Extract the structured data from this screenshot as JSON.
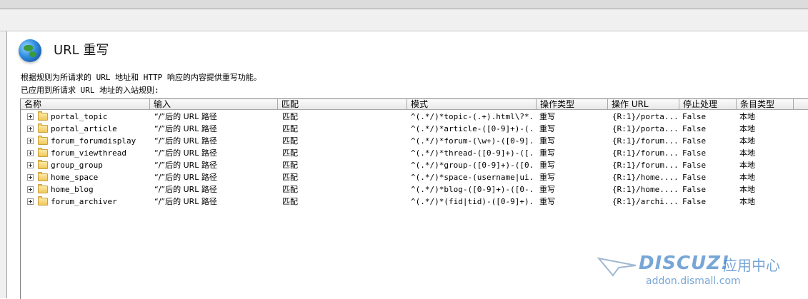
{
  "header": {
    "title": "URL 重写",
    "icon": "globe-icon"
  },
  "description": "根据规则为所请求的 URL 地址和 HTTP 响应的内容提供重写功能。",
  "applied_label": "已应用到所请求 URL 地址的入站规则:",
  "table": {
    "columns": [
      "名称",
      "输入",
      "匹配",
      "模式",
      "操作类型",
      "操作 URL",
      "停止处理",
      "条目类型"
    ],
    "rows": [
      {
        "name": "portal_topic",
        "input": "“/”后的 URL 路径",
        "match": "匹配",
        "pattern": "^(.*/)*topic-(.+).html\\?*...",
        "action_type": "重写",
        "action_url": "{R:1}/porta...",
        "stop": "False",
        "entry_type": "本地"
      },
      {
        "name": "portal_article",
        "input": "“/”后的 URL 路径",
        "match": "匹配",
        "pattern": "^(.*/)*article-([0-9]+)-(...",
        "action_type": "重写",
        "action_url": "{R:1}/porta...",
        "stop": "False",
        "entry_type": "本地"
      },
      {
        "name": "forum_forumdisplay",
        "input": "“/”后的 URL 路径",
        "match": "匹配",
        "pattern": "^(.*/)*forum-(\\w+)-([0-9]...",
        "action_type": "重写",
        "action_url": "{R:1}/forum...",
        "stop": "False",
        "entry_type": "本地"
      },
      {
        "name": "forum_viewthread",
        "input": "“/”后的 URL 路径",
        "match": "匹配",
        "pattern": "^(.*/)*thread-([0-9]+)-([...",
        "action_type": "重写",
        "action_url": "{R:1}/forum...",
        "stop": "False",
        "entry_type": "本地"
      },
      {
        "name": "group_group",
        "input": "“/”后的 URL 路径",
        "match": "匹配",
        "pattern": "^(.*/)*group-([0-9]+)-([0...",
        "action_type": "重写",
        "action_url": "{R:1}/forum...",
        "stop": "False",
        "entry_type": "本地"
      },
      {
        "name": "home_space",
        "input": "“/”后的 URL 路径",
        "match": "匹配",
        "pattern": "^(.*/)*space-(username|ui...",
        "action_type": "重写",
        "action_url": "{R:1}/home....",
        "stop": "False",
        "entry_type": "本地"
      },
      {
        "name": "home_blog",
        "input": "“/”后的 URL 路径",
        "match": "匹配",
        "pattern": "^(.*/)*blog-([0-9]+)-([0-...",
        "action_type": "重写",
        "action_url": "{R:1}/home....",
        "stop": "False",
        "entry_type": "本地"
      },
      {
        "name": "forum_archiver",
        "input": "“/”后的 URL 路径",
        "match": "匹配",
        "pattern": "^(.*/)*(fid|tid)-([0-9]+)...",
        "action_type": "重写",
        "action_url": "{R:1}/archi...",
        "stop": "False",
        "entry_type": "本地"
      }
    ]
  },
  "watermark": {
    "brand": "DISCUZ!",
    "subtitle": "应用中心",
    "url": "addon.dismall.com",
    "color": "#4a89c9"
  }
}
